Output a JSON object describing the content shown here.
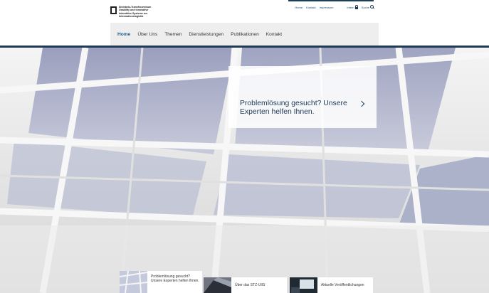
{
  "header": {
    "org_name": "Steinbeis-Transferzentrum\nUsability und innovative\ninteraktive Systeme zur\nInformationslogistik",
    "util_nav": [
      "Home",
      "Kontakt",
      "Impressum"
    ],
    "intern_label": "Intern",
    "search_label": "Suche",
    "icons": {
      "intern": "lock-icon",
      "search": "search-icon"
    }
  },
  "nav": {
    "items": [
      "Home",
      "Über Uns",
      "Themen",
      "Dienstleistungen",
      "Publikationen",
      "Kontakt"
    ],
    "active": "Home"
  },
  "hero": {
    "callout": "Problemlösung gesucht? Unsere Experten helfen Ihnen."
  },
  "cards": [
    {
      "text": "Problemlösung gesucht? Unsere Experten helfen Ihnen."
    },
    {
      "text": "Über das STZ-UIIS"
    },
    {
      "text": "Aktuelle Veröffentlichungen"
    }
  ],
  "colors": {
    "accent": "#1e3a55",
    "link": "#1e5c8a",
    "nav_bg": "#eeeeee"
  }
}
